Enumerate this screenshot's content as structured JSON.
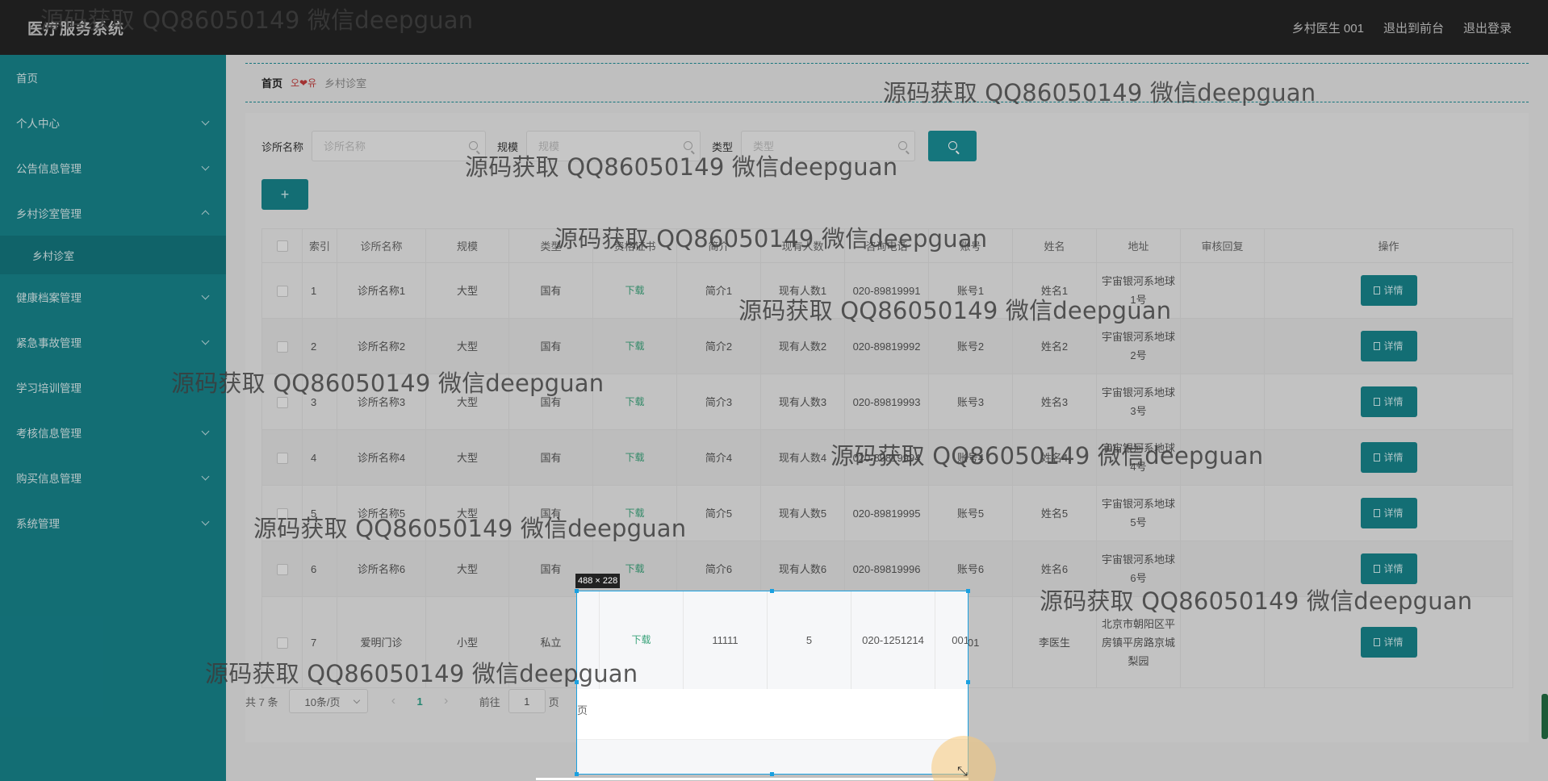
{
  "app": {
    "title": "医疗服务系统"
  },
  "topnav": {
    "user": "乡村医生 001",
    "front": "退出到前台",
    "logout": "退出登录"
  },
  "sidebar": {
    "items": [
      {
        "label": "首页",
        "chevron": "none"
      },
      {
        "label": "个人中心",
        "chevron": "down"
      },
      {
        "label": "公告信息管理",
        "chevron": "down"
      },
      {
        "label": "乡村诊室管理",
        "chevron": "up"
      },
      {
        "label": "健康档案管理",
        "chevron": "down"
      },
      {
        "label": "紧急事故管理",
        "chevron": "down"
      },
      {
        "label": "学习培训管理",
        "chevron": "none"
      },
      {
        "label": "考核信息管理",
        "chevron": "down"
      },
      {
        "label": "购买信息管理",
        "chevron": "down"
      },
      {
        "label": "系统管理",
        "chevron": "down"
      }
    ],
    "sub_item": "乡村诊室"
  },
  "breadcrumb": {
    "home": "首页",
    "sep": "오❤유",
    "current": "乡村诊室"
  },
  "search": {
    "name_label": "诊所名称",
    "name_placeholder": "诊所名称",
    "scale_label": "规模",
    "scale_placeholder": "规模",
    "type_label": "类型",
    "type_placeholder": "类型"
  },
  "add_label": "+",
  "table": {
    "headers": [
      "索引",
      "诊所名称",
      "规模",
      "类型",
      "资格证书",
      "简介",
      "现有人数",
      "咨询电话",
      "账号",
      "姓名",
      "地址",
      "审核回复",
      "操作"
    ],
    "rows": [
      {
        "idx": "1",
        "name": "诊所名称1",
        "scale": "大型",
        "type": "国有",
        "cert": "下载",
        "intro": "简介1",
        "count": "现有人数1",
        "phone": "020-89819991",
        "account": "账号1",
        "person": "姓名1",
        "address": "宇宙银河系地球1号",
        "reply": ""
      },
      {
        "idx": "2",
        "name": "诊所名称2",
        "scale": "大型",
        "type": "国有",
        "cert": "下载",
        "intro": "简介2",
        "count": "现有人数2",
        "phone": "020-89819992",
        "account": "账号2",
        "person": "姓名2",
        "address": "宇宙银河系地球2号",
        "reply": ""
      },
      {
        "idx": "3",
        "name": "诊所名称3",
        "scale": "大型",
        "type": "国有",
        "cert": "下载",
        "intro": "简介3",
        "count": "现有人数3",
        "phone": "020-89819993",
        "account": "账号3",
        "person": "姓名3",
        "address": "宇宙银河系地球3号",
        "reply": ""
      },
      {
        "idx": "4",
        "name": "诊所名称4",
        "scale": "大型",
        "type": "国有",
        "cert": "下载",
        "intro": "简介4",
        "count": "现有人数4",
        "phone": "020-89819994",
        "account": "账号4",
        "person": "姓名4",
        "address": "宇宙银河系地球4号",
        "reply": ""
      },
      {
        "idx": "5",
        "name": "诊所名称5",
        "scale": "大型",
        "type": "国有",
        "cert": "下载",
        "intro": "简介5",
        "count": "现有人数5",
        "phone": "020-89819995",
        "account": "账号5",
        "person": "姓名5",
        "address": "宇宙银河系地球5号",
        "reply": ""
      },
      {
        "idx": "6",
        "name": "诊所名称6",
        "scale": "大型",
        "type": "国有",
        "cert": "下载",
        "intro": "简介6",
        "count": "现有人数6",
        "phone": "020-89819996",
        "account": "账号6",
        "person": "姓名6",
        "address": "宇宙银河系地球6号",
        "reply": ""
      },
      {
        "idx": "7",
        "name": "爱明门诊",
        "scale": "小型",
        "type": "私立",
        "cert": "下载",
        "intro": "11111",
        "count": "5",
        "phone": "020-1251214",
        "account": "001",
        "person": "李医生",
        "address": "北京市朝阳区平房镇平房路京城梨园",
        "reply": ""
      }
    ],
    "detail_label": "详情"
  },
  "pager": {
    "total": "共 7 条",
    "size": "10条/页",
    "prev": "‹",
    "page": "1",
    "next": "›",
    "goto": "前往",
    "goto_value": "1",
    "goto_suffix": "页"
  },
  "selection": {
    "label": "488 × 228"
  },
  "watermark": "源码获取 QQ86050149 微信deepguan",
  "colors": {
    "accent": "#17838b",
    "topbar": "#242424",
    "download": "#3aa37a"
  }
}
